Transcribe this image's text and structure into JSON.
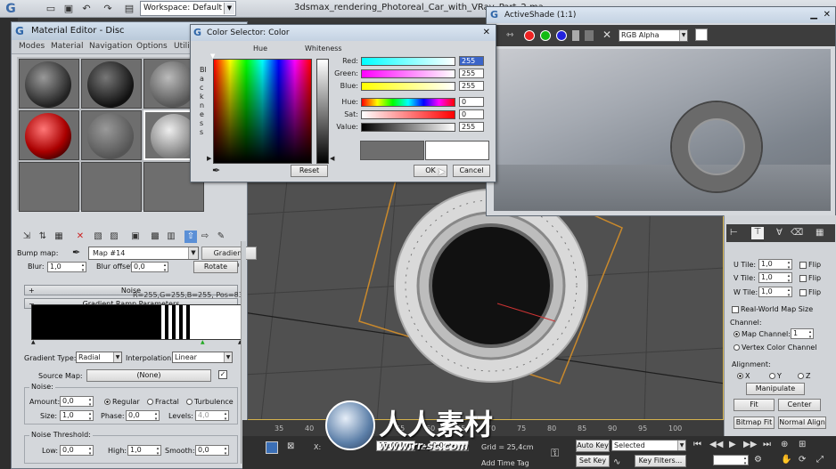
{
  "app": {
    "workspace_label": "Workspace: Default",
    "document_title": "3dsmax_rendering_Photoreal_Car_with_VRay_Part_2.ma"
  },
  "material_editor": {
    "title": "Material Editor - Disc",
    "menus": [
      "Modes",
      "Material",
      "Navigation",
      "Options",
      "Utili"
    ],
    "bump_label": "Bump map:",
    "map_name": "Map #14",
    "map_type_button": "Gradient Ramp",
    "blur_row": {
      "blur_label": "Blur:",
      "blur_value": "1,0",
      "offset_label": "Blur offset:",
      "offset_value": "0,0",
      "rotate_label": "Rotate"
    },
    "rollouts": {
      "noise": "Noise",
      "gradient_params": "Gradient Ramp Parameters"
    },
    "ramp_readout": "R=255,G=255,B=255, Pos=83",
    "gradient_type_label": "Gradient Type:",
    "gradient_type_value": "Radial",
    "interpolation_label": "Interpolation:",
    "interpolation_value": "Linear",
    "source_map_label": "Source Map:",
    "source_map_value": "(None)",
    "noise": {
      "group_label": "Noise:",
      "amount_label": "Amount:",
      "amount_value": "0,0",
      "regular": "Regular",
      "fractal": "Fractal",
      "turbulence": "Turbulence",
      "size_label": "Size:",
      "size_value": "1,0",
      "phase_label": "Phase:",
      "phase_value": "0,0",
      "levels_label": "Levels:",
      "levels_value": "4,0"
    },
    "threshold": {
      "group_label": "Noise Threshold:",
      "low_label": "Low:",
      "low_value": "0,0",
      "high_label": "High:",
      "high_value": "1,0",
      "smooth_label": "Smooth:",
      "smooth_value": "0,0"
    }
  },
  "color_selector": {
    "title": "Color Selector: Color",
    "hue_label": "Hue",
    "whiteness_label": "Whiteness",
    "blackness_label": "Blackness",
    "channels": [
      {
        "label": "Red:",
        "value": "255"
      },
      {
        "label": "Green:",
        "value": "255"
      },
      {
        "label": "Blue:",
        "value": "255"
      },
      {
        "label": "Hue:",
        "value": "0"
      },
      {
        "label": "Sat:",
        "value": "0"
      },
      {
        "label": "Value:",
        "value": "255"
      }
    ],
    "reset": "Reset",
    "ok": "OK",
    "cancel": "Cancel"
  },
  "active_shade": {
    "title": "ActiveShade (1:1)",
    "channel": "RGB Alpha"
  },
  "command_panel": {
    "utile_label": "U Tile:",
    "utile_value": "1,0",
    "vtile_label": "V Tile:",
    "vtile_value": "1,0",
    "wtile_label": "W Tile:",
    "wtile_value": "1,0",
    "flip": "Flip",
    "real_world": "Real-World Map Size",
    "channel_group": "Channel:",
    "map_channel_label": "Map Channel:",
    "map_channel_value": "1",
    "vertex_color": "Vertex Color Channel",
    "alignment_group": "Alignment:",
    "axes": [
      "X",
      "Y",
      "Z"
    ],
    "manipulate": "Manipulate",
    "fit": "Fit",
    "center": "Center",
    "bitmap_fit": "Bitmap Fit",
    "normal_align": "Normal Align"
  },
  "timeline": {
    "ticks": [
      "35",
      "40",
      "45",
      "50",
      "55",
      "60",
      "65",
      "70",
      "75",
      "80",
      "85",
      "90",
      "95",
      "100"
    ]
  },
  "statusbar": {
    "x_label": "X:",
    "y_value": "15,404cm",
    "z_label": "Z:",
    "z_value": "0,0cm",
    "grid": "Grid = 25,4cm",
    "add_time_tag": "Add Time Tag",
    "auto_key": "Auto Key",
    "set_key": "Set Key",
    "selected": "Selected",
    "key_filters": "Key Filters..."
  },
  "watermark": {
    "text_cn": "人人素材",
    "url": "www.rr-sc.com"
  }
}
